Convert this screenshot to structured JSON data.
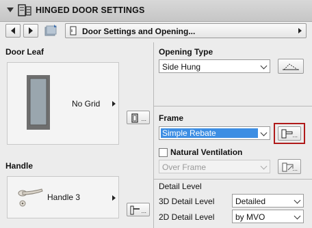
{
  "panel": {
    "title": "HINGED DOOR SETTINGS"
  },
  "nav": {
    "dropdown_label": "Door Settings and Opening..."
  },
  "door_leaf": {
    "heading": "Door Leaf",
    "preview_label": "No Grid"
  },
  "handle": {
    "heading": "Handle",
    "preview_label": "Handle 3"
  },
  "opening_type": {
    "heading": "Opening Type",
    "value": "Side Hung"
  },
  "frame": {
    "heading": "Frame",
    "value": "Simple Rebate",
    "natural_ventilation_label": "Natural Ventilation",
    "natural_ventilation_checked": false,
    "ventilation_value": "Over Frame"
  },
  "detail_level": {
    "heading": "Detail Level",
    "label_3d": "3D Detail Level",
    "value_3d": "Detailed",
    "label_2d": "2D Detail Level",
    "value_2d": "by MVO"
  },
  "colors": {
    "selection_blue": "#3d8ee3",
    "highlight_red": "#b01a1a",
    "door_frame": "#707070",
    "glass": "#9aa6ae"
  },
  "icons": {
    "collapse": "chevron-down-icon",
    "panel": "door-settings-icon",
    "prev": "arrow-left-icon",
    "next": "arrow-right-icon",
    "favorites": "favorites-icon",
    "door_page": "door-page-icon",
    "opening": "opening-settings-icon",
    "frame": "frame-settings-icon",
    "ventilation": "ventilation-settings-icon",
    "leaf": "leaf-settings-icon",
    "handle": "handle-settings-icon"
  }
}
